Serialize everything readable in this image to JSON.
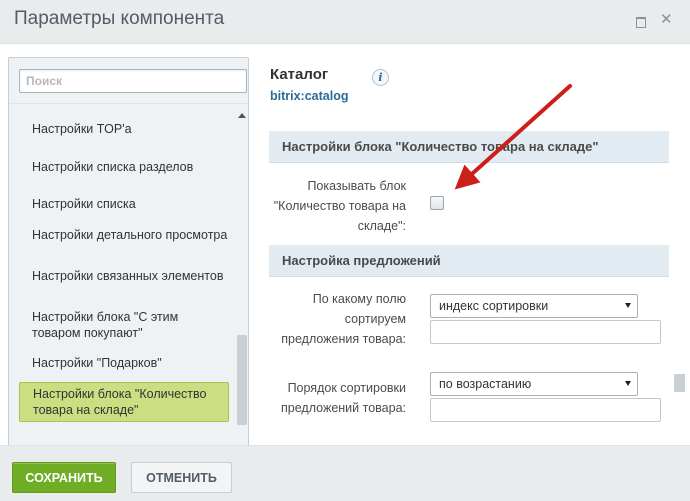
{
  "window": {
    "title": "Параметры компонента",
    "maximize_icon": "maximize-icon",
    "close_icon": "close-icon"
  },
  "sidebar": {
    "search": {
      "placeholder": "Поиск",
      "value": ""
    },
    "items": [
      {
        "label": "Настройки TOP'а"
      },
      {
        "label": "Настройки списка разделов"
      },
      {
        "label": "Настройки списка"
      },
      {
        "label": "Настройки детального просмотра"
      },
      {
        "label": "Настройки связанных элементов"
      },
      {
        "label": "Настройки блока \"С этим товаром покупают\""
      },
      {
        "label": "Настройки \"Подарков\""
      },
      {
        "label": "Настройки блока \"Количество товара на складе\"",
        "selected": true
      }
    ]
  },
  "component": {
    "name": "Каталог",
    "code": "bitrix:catalog",
    "info_icon_glyph": "i"
  },
  "sections": [
    {
      "title": "Настройки блока \"Количество товара на складе\"",
      "params": [
        {
          "label": "Показывать блок \"Количество товара на складе\":",
          "type": "checkbox",
          "checked": false
        }
      ]
    },
    {
      "title": "Настройка предложений",
      "params": [
        {
          "label": "По какому полю сортируем предложения товара:",
          "type": "select",
          "value": "индекс сортировки",
          "extra": ""
        },
        {
          "label": "Порядок сортировки предложений товара:",
          "type": "select",
          "value": "по возрастанию",
          "extra": ""
        }
      ]
    }
  ],
  "footer": {
    "save_label": "СОХРАНИТЬ",
    "cancel_label": "ОТМЕНИТЬ"
  },
  "colors": {
    "save_button": "#6fae24",
    "selected_item": "#ccde82",
    "section_header": "#e1ebf1",
    "annotation_arrow": "#cc1f1a",
    "link": "#2a6a9a"
  }
}
